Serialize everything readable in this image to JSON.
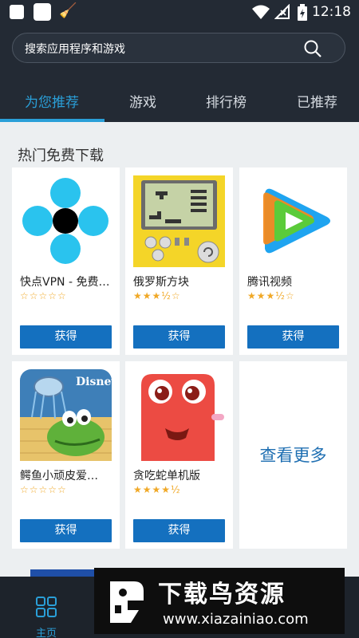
{
  "status": {
    "time": "12:18"
  },
  "search": {
    "placeholder": "搜索应用程序和游戏"
  },
  "tabs": [
    {
      "label": "为您推荐",
      "active": true
    },
    {
      "label": "游戏",
      "active": false
    },
    {
      "label": "排行榜",
      "active": false
    },
    {
      "label": "已推荐",
      "active": false
    }
  ],
  "section": {
    "title": "热门免费下载"
  },
  "apps": [
    {
      "name": "快点VPN - 免费…",
      "stars": "☆☆☆☆☆",
      "rating": 0,
      "button": "获得"
    },
    {
      "name": "俄罗斯方块",
      "stars": "★★★½☆",
      "rating": 3.5,
      "button": "获得"
    },
    {
      "name": "腾讯视频",
      "stars": "★★★½☆",
      "rating": 3.5,
      "button": "获得"
    },
    {
      "name": "鳄鱼小顽皮爱…",
      "stars": "☆☆☆☆☆",
      "rating": 0,
      "button": "获得"
    },
    {
      "name": "贪吃蛇单机版",
      "stars": "★★★★½",
      "rating": 4.5,
      "button": "获得"
    }
  ],
  "see_more": {
    "label": "查看更多"
  },
  "bottom_nav": {
    "home_label": "主页"
  },
  "watermark": {
    "title": "下载鸟资源",
    "url": "www.xiazainiao.com"
  },
  "colors": {
    "accent": "#2a9fd8",
    "button": "#1470bf",
    "header_bg": "#232a34"
  }
}
